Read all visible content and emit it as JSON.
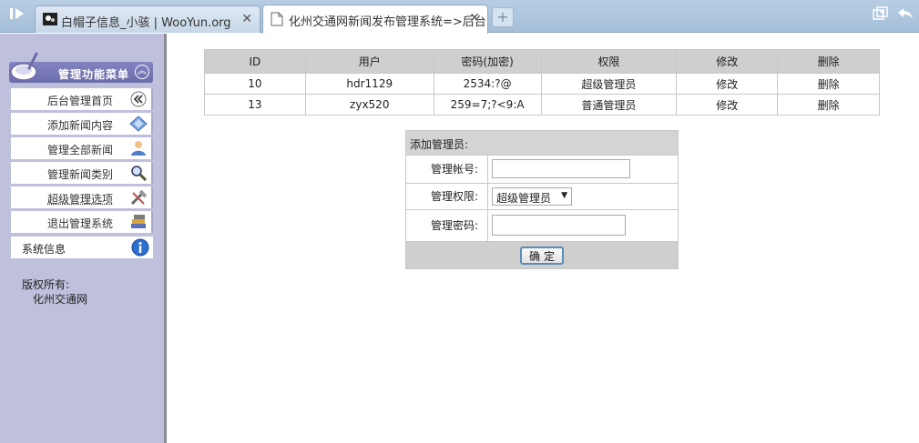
{
  "browser": {
    "tabs": [
      {
        "title": "白帽子信息_小骇 | WooYun.org",
        "active": false
      },
      {
        "title": "化州交通网新闻发布管理系统=>后台",
        "active": true
      }
    ],
    "new_tab": "+"
  },
  "sidebar": {
    "menu_title": "管理功能菜单",
    "items": [
      {
        "label": "后台管理首页",
        "icon": "double-chevron-left-icon"
      },
      {
        "label": "添加新闻内容",
        "icon": "diamond-icon"
      },
      {
        "label": "管理全部新闻",
        "icon": "user-icon"
      },
      {
        "label": "管理新闻类别",
        "icon": "magnifier-icon"
      },
      {
        "label": "超级管理选项",
        "icon": "tools-icon"
      },
      {
        "label": "退出管理系统",
        "icon": "books-icon"
      }
    ],
    "system_info": "系统信息",
    "copyright_label": "版权所有:",
    "copyright_owner": "化州交通网"
  },
  "users_table": {
    "headers": [
      "ID",
      "用户",
      "密码(加密)",
      "权限",
      "修改",
      "删除"
    ],
    "rows": [
      [
        "10",
        "hdr1129",
        "2534:?@",
        "超级管理员",
        "修改",
        "删除"
      ],
      [
        "13",
        "zyx520",
        "259=7;?<9:A",
        "普通管理员",
        "修改",
        "删除"
      ]
    ]
  },
  "add_admin": {
    "title": "添加管理员:",
    "account_label": "管理帐号:",
    "account_value": "",
    "role_label": "管理权限:",
    "role_value": "超级管理员",
    "password_label": "管理密码:",
    "password_value": "",
    "submit_label": "确定"
  },
  "colors": {
    "sidebar_bg": "#bec0dc",
    "menu_header": "#7576b6",
    "table_header": "#cfcfcf",
    "tab_strip": "#aec6de"
  }
}
